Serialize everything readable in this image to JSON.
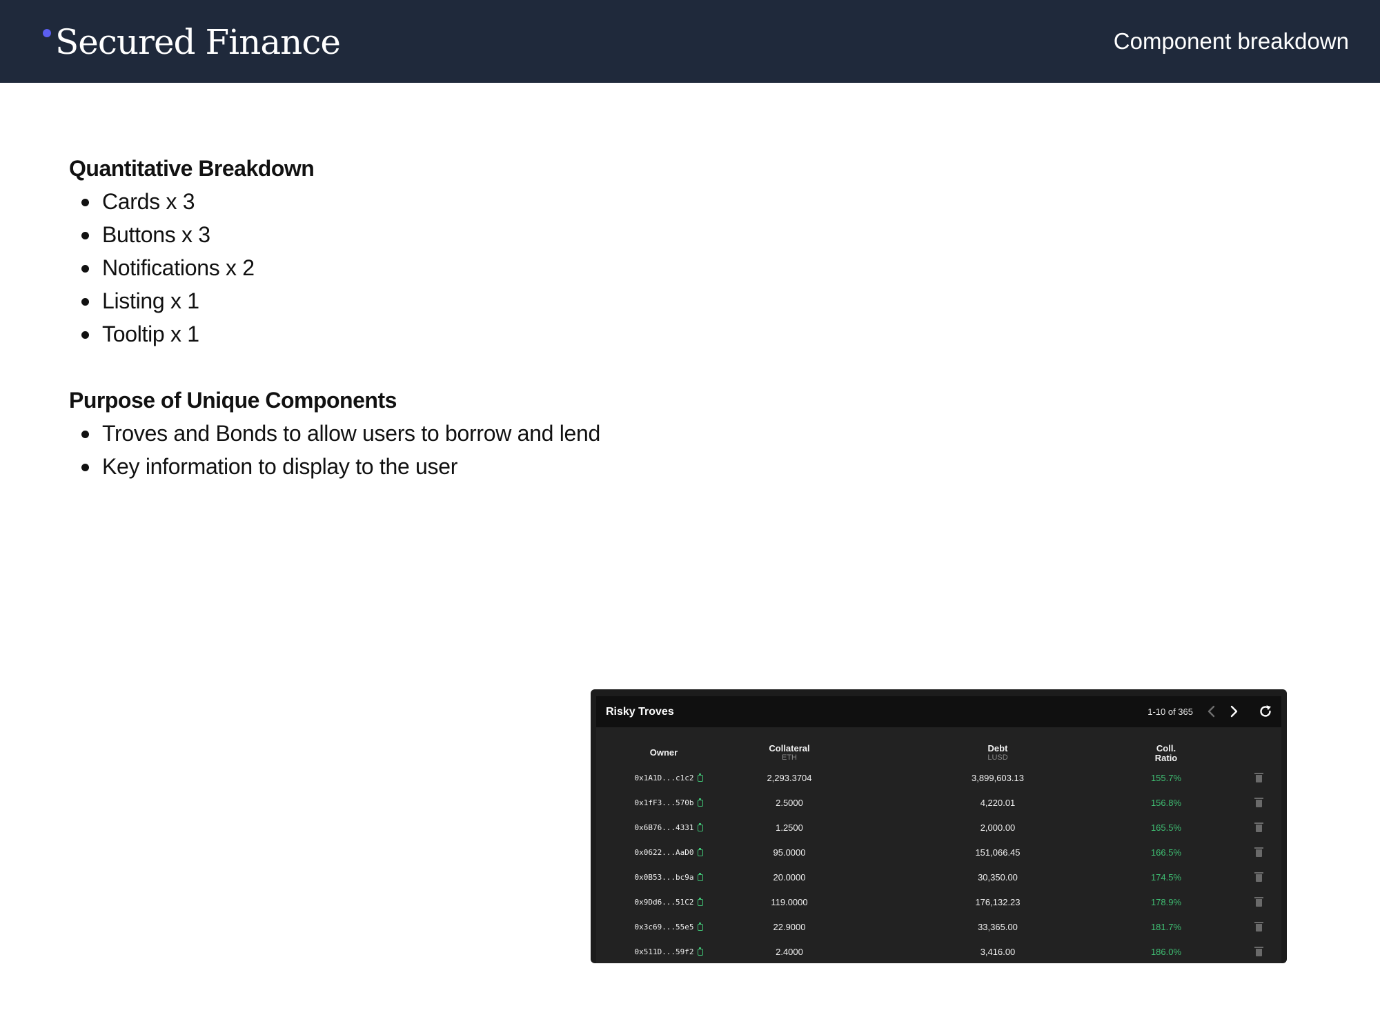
{
  "header": {
    "brand": "Secured Finance",
    "section_label": "Component breakdown",
    "accent_color": "#5b5ef0",
    "background_color": "#1f293b"
  },
  "breakdown": {
    "title": "Quantitative Breakdown",
    "items": [
      "Cards x 3",
      "Buttons x 3",
      "Notifications x 2",
      "Listing x 1",
      "Tooltip x 1"
    ]
  },
  "purpose": {
    "title": "Purpose of Unique Components",
    "items": [
      "Troves and Bonds to allow users to borrow and lend",
      "Key information to display to the user"
    ]
  },
  "troves": {
    "title": "Risky Troves",
    "range": "1-10 of 365",
    "columns": {
      "owner": "Owner",
      "collateral": "Collateral",
      "collateral_unit": "ETH",
      "debt": "Debt",
      "debt_unit": "LUSD",
      "ratio_line1": "Coll.",
      "ratio_line2": "Ratio"
    },
    "ratio_color": "#3fbf73",
    "rows": [
      {
        "owner": "0x1A1D...c1c2",
        "collateral": "2,293.3704",
        "debt": "3,899,603.13",
        "ratio": "155.7%"
      },
      {
        "owner": "0x1fF3...570b",
        "collateral": "2.5000",
        "debt": "4,220.01",
        "ratio": "156.8%"
      },
      {
        "owner": "0x6B76...4331",
        "collateral": "1.2500",
        "debt": "2,000.00",
        "ratio": "165.5%"
      },
      {
        "owner": "0x0622...AaD0",
        "collateral": "95.0000",
        "debt": "151,066.45",
        "ratio": "166.5%"
      },
      {
        "owner": "0x0B53...bc9a",
        "collateral": "20.0000",
        "debt": "30,350.00",
        "ratio": "174.5%"
      },
      {
        "owner": "0x9Dd6...51C2",
        "collateral": "119.0000",
        "debt": "176,132.23",
        "ratio": "178.9%"
      },
      {
        "owner": "0x3c69...55e5",
        "collateral": "22.9000",
        "debt": "33,365.00",
        "ratio": "181.7%"
      },
      {
        "owner": "0x511D...59f2",
        "collateral": "2.4000",
        "debt": "3,416.00",
        "ratio": "186.0%"
      }
    ]
  }
}
